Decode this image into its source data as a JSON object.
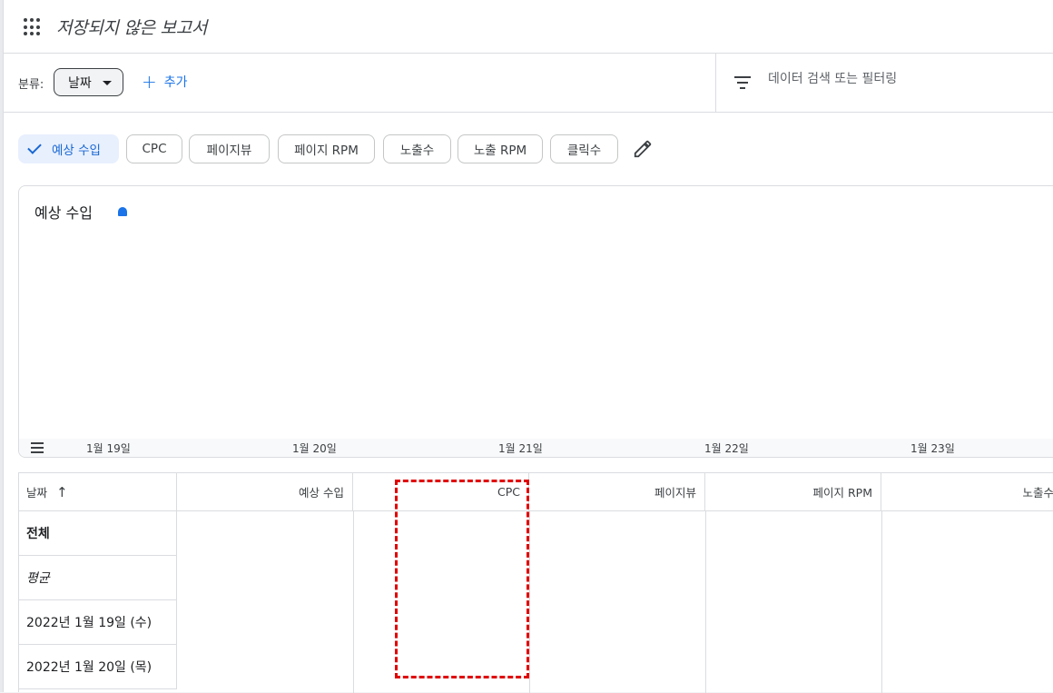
{
  "header": {
    "title": "저장되지 않은 보고서",
    "apps_icon": "apps-grid-icon"
  },
  "toolbar": {
    "group_label": "분류:",
    "dimension": "날짜",
    "add_label": "추가",
    "filter_placeholder": "데이터 검색 또는 필터링"
  },
  "metrics": [
    {
      "label": "예상 수입",
      "selected": true
    },
    {
      "label": "CPC",
      "selected": false
    },
    {
      "label": "페이지뷰",
      "selected": false
    },
    {
      "label": "페이지 RPM",
      "selected": false
    },
    {
      "label": "노출수",
      "selected": false
    },
    {
      "label": "노출 RPM",
      "selected": false
    },
    {
      "label": "클릭수",
      "selected": false
    }
  ],
  "chart": {
    "title": "예상 수입",
    "series_color": "#1a73e8",
    "x_labels": [
      "1월 19일",
      "1월 20일",
      "1월 21일",
      "1월 22일",
      "1월 23일"
    ]
  },
  "table": {
    "headers": [
      "날짜",
      "예상 수입",
      "CPC",
      "페이지뷰",
      "페이지 RPM",
      "노출수"
    ],
    "rows": [
      "전체",
      "평균",
      "2022년 1월 19일 (수)",
      "2022년 1월 20일 (목)"
    ]
  }
}
